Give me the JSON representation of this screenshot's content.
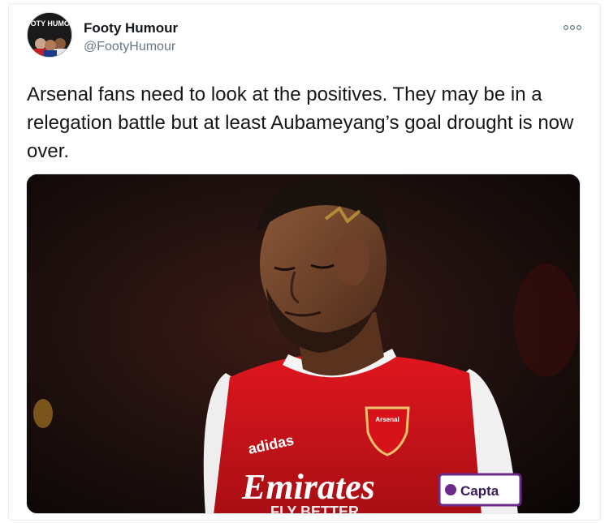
{
  "tweet": {
    "display_name": "Footy Humour",
    "handle": "@FootyHumour",
    "text": "Arsenal fans need to look at the positives. They may be in a relegation battle but at least Aubameyang’s goal drought is now over.",
    "avatar_text": "FOOTY HUMOUR",
    "more_icon": "more-options-icon"
  },
  "media": {
    "sponsor_text": "Emirates",
    "brand_text": "adidas",
    "captain_band_text": "Capta",
    "crest_text": "Arsenal",
    "shirt_lower_text": "FLY BETTER",
    "colors": {
      "shirt_red": "#d8121a",
      "sleeve_white": "#f2f2f2",
      "background_dark": "#1a0e0d"
    }
  }
}
